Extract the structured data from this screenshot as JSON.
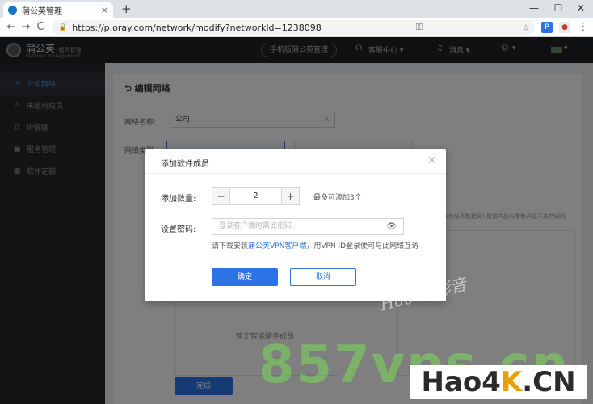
{
  "browser": {
    "tab_title": "蒲公英管理",
    "tab_close": "×",
    "new_tab": "+",
    "url": "https://p.oray.com/network/modify?networkId=1238098",
    "nav": {
      "back": "←",
      "forward": "→",
      "reload": "C"
    },
    "window_controls": {
      "minimize": "—",
      "maximize": "☐",
      "close": "✕"
    },
    "ext": [
      "P"
    ],
    "menu": "⋮"
  },
  "header": {
    "brand": "蒲公英",
    "brand_sub": "· 组网管理",
    "brand_en": "Network management",
    "mobile_button": "手机版蒲公英管理",
    "service": "客服中心 ▾",
    "messages": "消息 ▾",
    "account": "▾"
  },
  "sidebar": {
    "items": [
      {
        "label": "公司网络",
        "icon": "network-icon",
        "glyph": "◷",
        "active": true
      },
      {
        "label": "未组网成员",
        "icon": "user-icon",
        "glyph": "♙",
        "active": false
      },
      {
        "label": "IP管理",
        "icon": "ip-icon",
        "glyph": "▯",
        "active": false
      },
      {
        "label": "服务管理",
        "icon": "service-icon",
        "glyph": "▣",
        "active": false
      },
      {
        "label": "软件定制",
        "icon": "grid-icon",
        "glyph": "▦",
        "active": false
      }
    ]
  },
  "page": {
    "back_glyph": "⮌",
    "title": "编辑网络",
    "network_name_label": "网络名称:",
    "network_name_value": "公司",
    "network_name_clear": "×",
    "network_type_label": "网络类型:",
    "notice": "许地址不能相同! 渠道产品与零售产品不支持同网",
    "empty_hardware": "暂无智能硬件成员",
    "done_button": "完成"
  },
  "modal": {
    "title": "添加软件成员",
    "close": "×",
    "count_label": "添加数量:",
    "count_value": "2",
    "minus": "−",
    "plus": "+",
    "max_hint": "最多可添加3个",
    "password_label": "设置密码:",
    "password_placeholder": "登录客户端时需此密码",
    "eye_glyph": "👁",
    "download_hint_prefix": "请下载安装",
    "download_link": "蒲公英VPN客户端",
    "download_hint_suffix": "，用VPN ID登录便可与此网络互访",
    "confirm": "确定",
    "cancel": "取消"
  },
  "watermarks": {
    "hao4k_cn_text": "Hao4K影音",
    "vps": "857vps.cn",
    "hao4k_prefix": "Hao4",
    "hao4k_k": "K",
    "hao4k_suffix": ".CN"
  },
  "colors": {
    "accent": "#2c74e6",
    "header_bg": "#1f2226",
    "sidebar_bg": "#24282c"
  }
}
